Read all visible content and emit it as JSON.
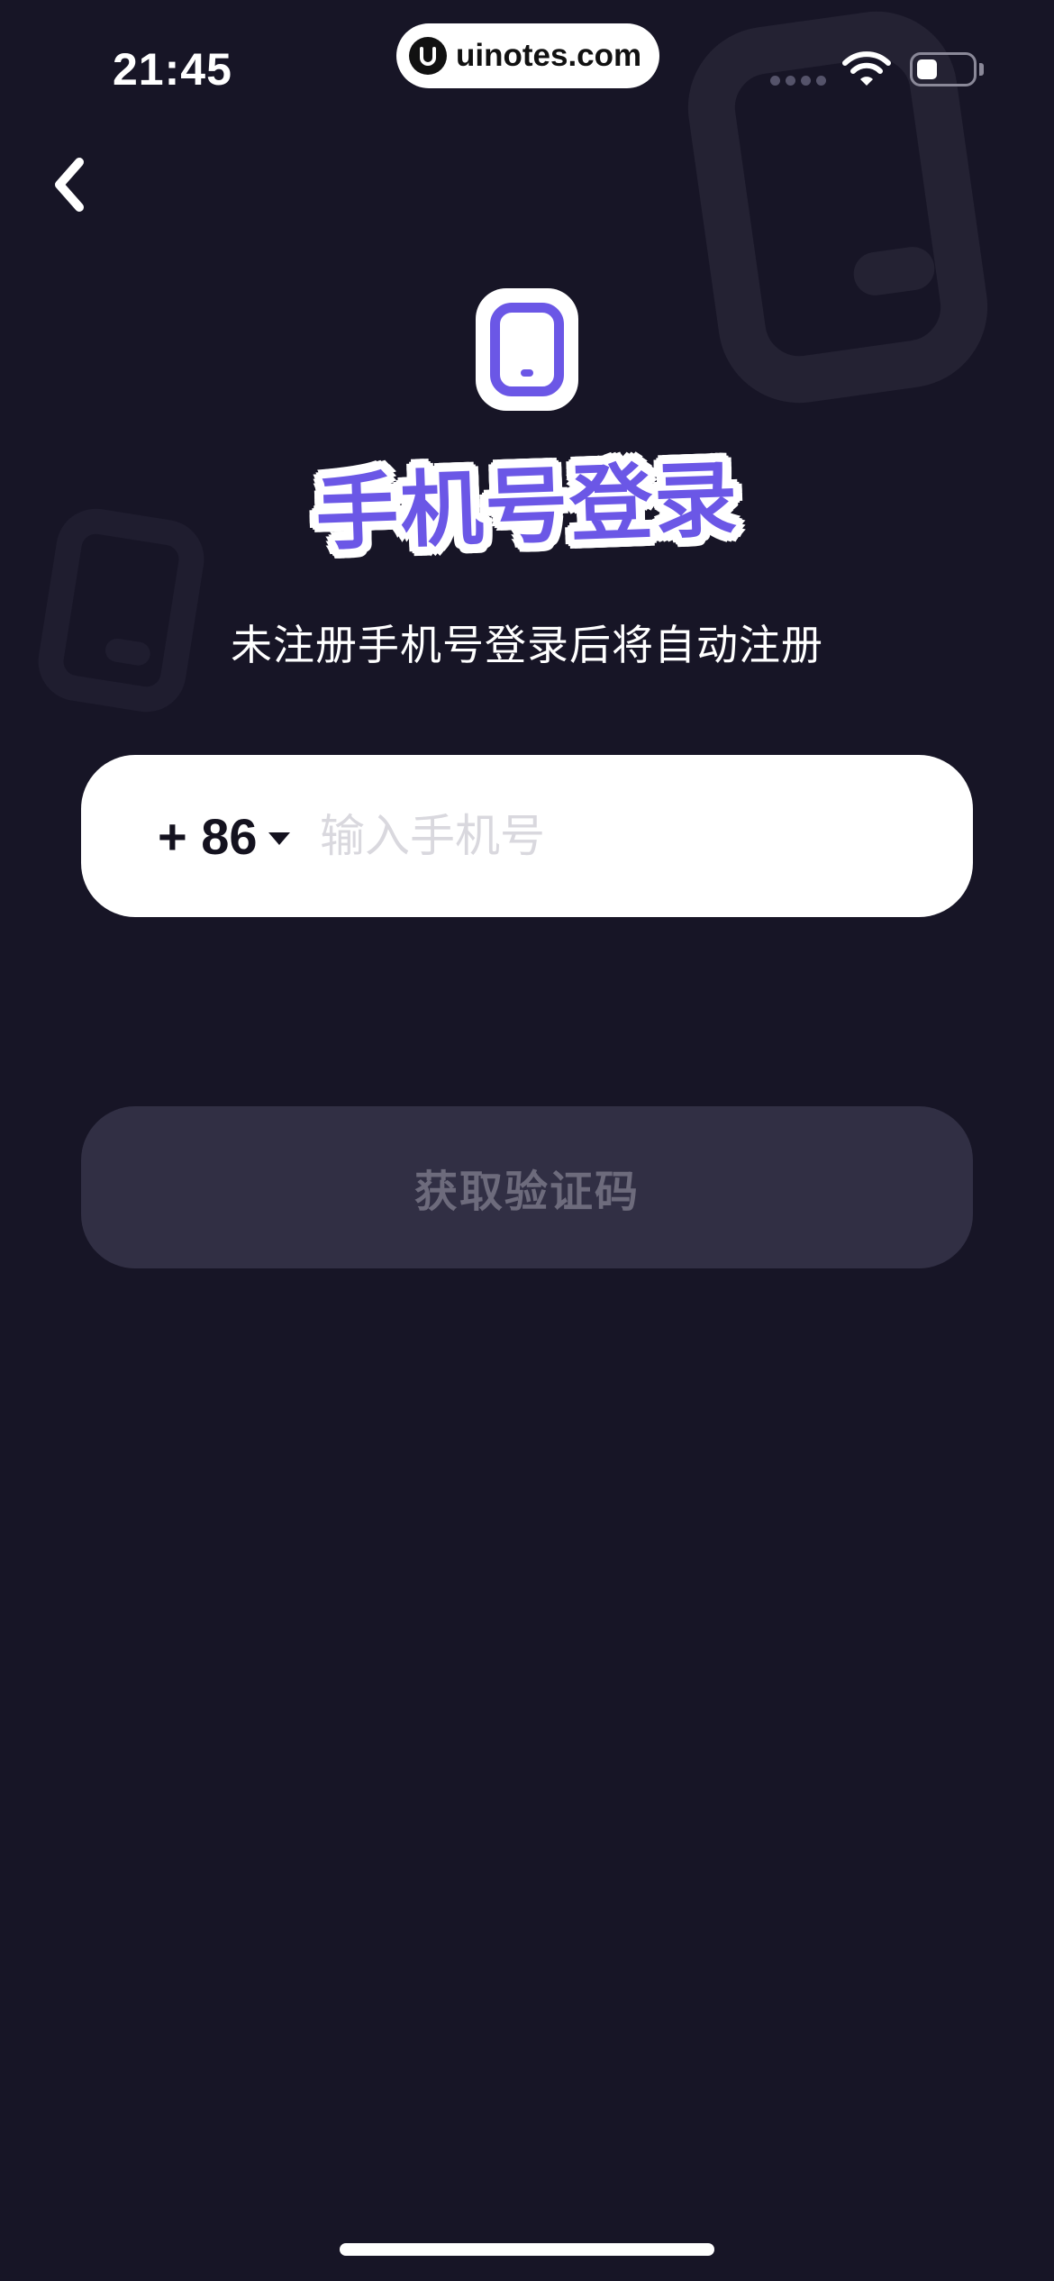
{
  "status_bar": {
    "time": "21:45",
    "url_badge": "uinotes.com"
  },
  "header": {
    "back_icon": "chevron-left-icon"
  },
  "hero": {
    "icon": "mobile-phone-icon",
    "title": "手机号登录",
    "subtitle": "未注册手机号登录后将自动注册"
  },
  "phone_field": {
    "country_code": "+ 86",
    "placeholder": "输入手机号",
    "value": ""
  },
  "actions": {
    "get_code_label": "获取验证码"
  },
  "colors": {
    "background": "#171526",
    "accent": "#6b57e6",
    "button_disabled": "#312f44"
  }
}
